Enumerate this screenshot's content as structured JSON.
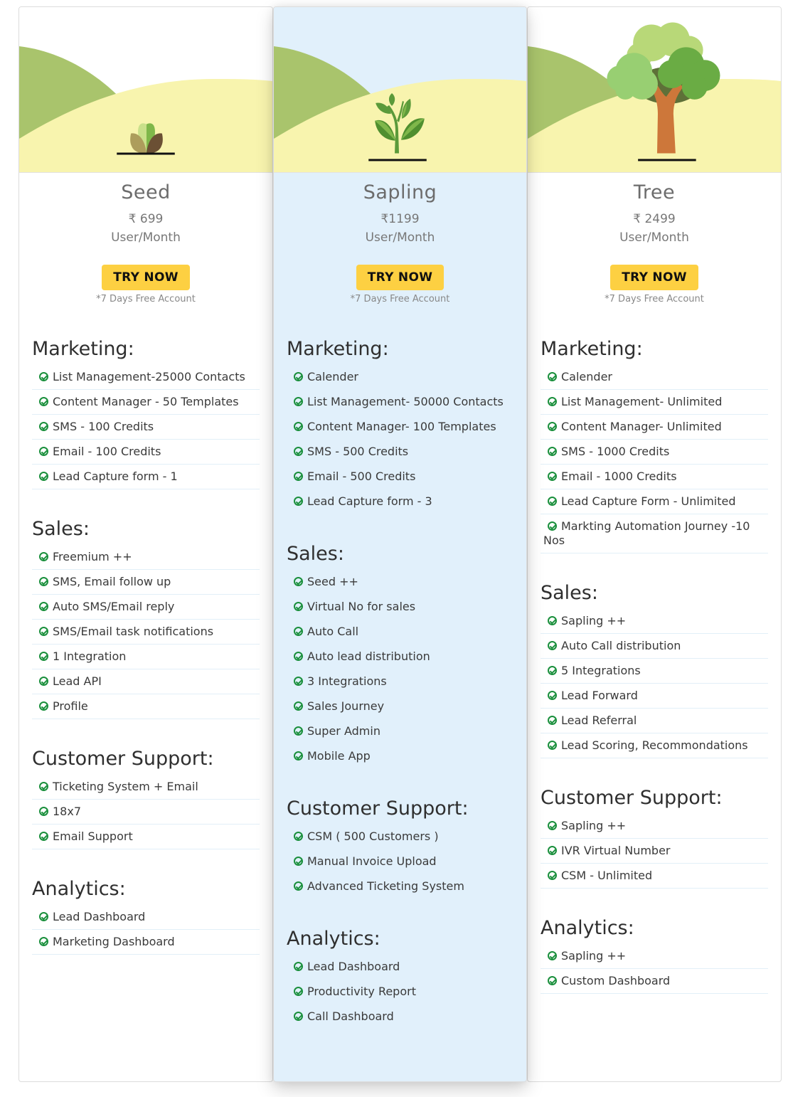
{
  "colors": {
    "accent_button": "#fdd042",
    "featured_bg": "#e1f0fb",
    "check_green": "#1a8f3c",
    "hill_dark": "#a9c46c",
    "hill_light": "#f8f4ae"
  },
  "plans": [
    {
      "name": "Seed",
      "price": "₹ 699",
      "unit": "User/Month",
      "cta": "TRY NOW",
      "note": "*7 Days Free Account",
      "illustration": "seed-icon",
      "featured": false,
      "sections": [
        {
          "title": "Marketing:",
          "items": [
            "List Management-25000 Contacts",
            "Content Manager - 50 Templates",
            "SMS - 100 Credits",
            "Email - 100 Credits",
            "Lead Capture form - 1"
          ]
        },
        {
          "title": "Sales:",
          "items": [
            "Freemium ++",
            "SMS, Email follow up",
            "Auto SMS/Email reply",
            "SMS/Email task notifications",
            "1 Integration",
            "Lead API",
            "Profile"
          ]
        },
        {
          "title": "Customer Support:",
          "items": [
            "Ticketing System + Email",
            "18x7",
            "Email Support"
          ]
        },
        {
          "title": "Analytics:",
          "items": [
            "Lead Dashboard",
            "Marketing Dashboard"
          ]
        }
      ]
    },
    {
      "name": "Sapling",
      "price": "₹1199",
      "unit": "User/Month",
      "cta": "TRY NOW",
      "note": "*7 Days Free Account",
      "illustration": "sapling-icon",
      "featured": true,
      "sections": [
        {
          "title": "Marketing:",
          "items": [
            "Calender",
            "List Management- 50000 Contacts",
            "Content Manager- 100 Templates",
            "SMS - 500 Credits",
            "Email - 500 Credits",
            "Lead Capture form - 3"
          ]
        },
        {
          "title": "Sales:",
          "items": [
            "Seed ++",
            "Virtual No for sales",
            "Auto Call",
            "Auto lead distribution",
            "3 Integrations",
            "Sales Journey",
            "Super Admin",
            "Mobile App"
          ]
        },
        {
          "title": "Customer Support:",
          "items": [
            "CSM ( 500 Customers )",
            "Manual Invoice Upload",
            "Advanced Ticketing System"
          ]
        },
        {
          "title": "Analytics:",
          "items": [
            "Lead Dashboard",
            "Productivity Report",
            "Call Dashboard"
          ]
        }
      ]
    },
    {
      "name": "Tree",
      "price": "₹ 2499",
      "unit": "User/Month",
      "cta": "TRY NOW",
      "note": "*7 Days Free Account",
      "illustration": "tree-icon",
      "featured": false,
      "sections": [
        {
          "title": "Marketing:",
          "items": [
            "Calender",
            "List Management- Unlimited",
            "Content Manager- Unlimited",
            "SMS - 1000 Credits",
            "Email - 1000 Credits",
            "Lead Capture Form - Unlimited",
            "Markting Automation Journey -10 Nos"
          ]
        },
        {
          "title": "Sales:",
          "items": [
            "Sapling ++",
            "Auto Call distribution",
            "5 Integrations",
            "Lead Forward",
            "Lead Referral",
            "Lead Scoring, Recommondations"
          ]
        },
        {
          "title": "Customer Support:",
          "items": [
            "Sapling ++",
            "IVR Virtual Number",
            "CSM - Unlimited"
          ]
        },
        {
          "title": "Analytics:",
          "items": [
            "Sapling ++",
            "Custom Dashboard"
          ]
        }
      ]
    }
  ]
}
